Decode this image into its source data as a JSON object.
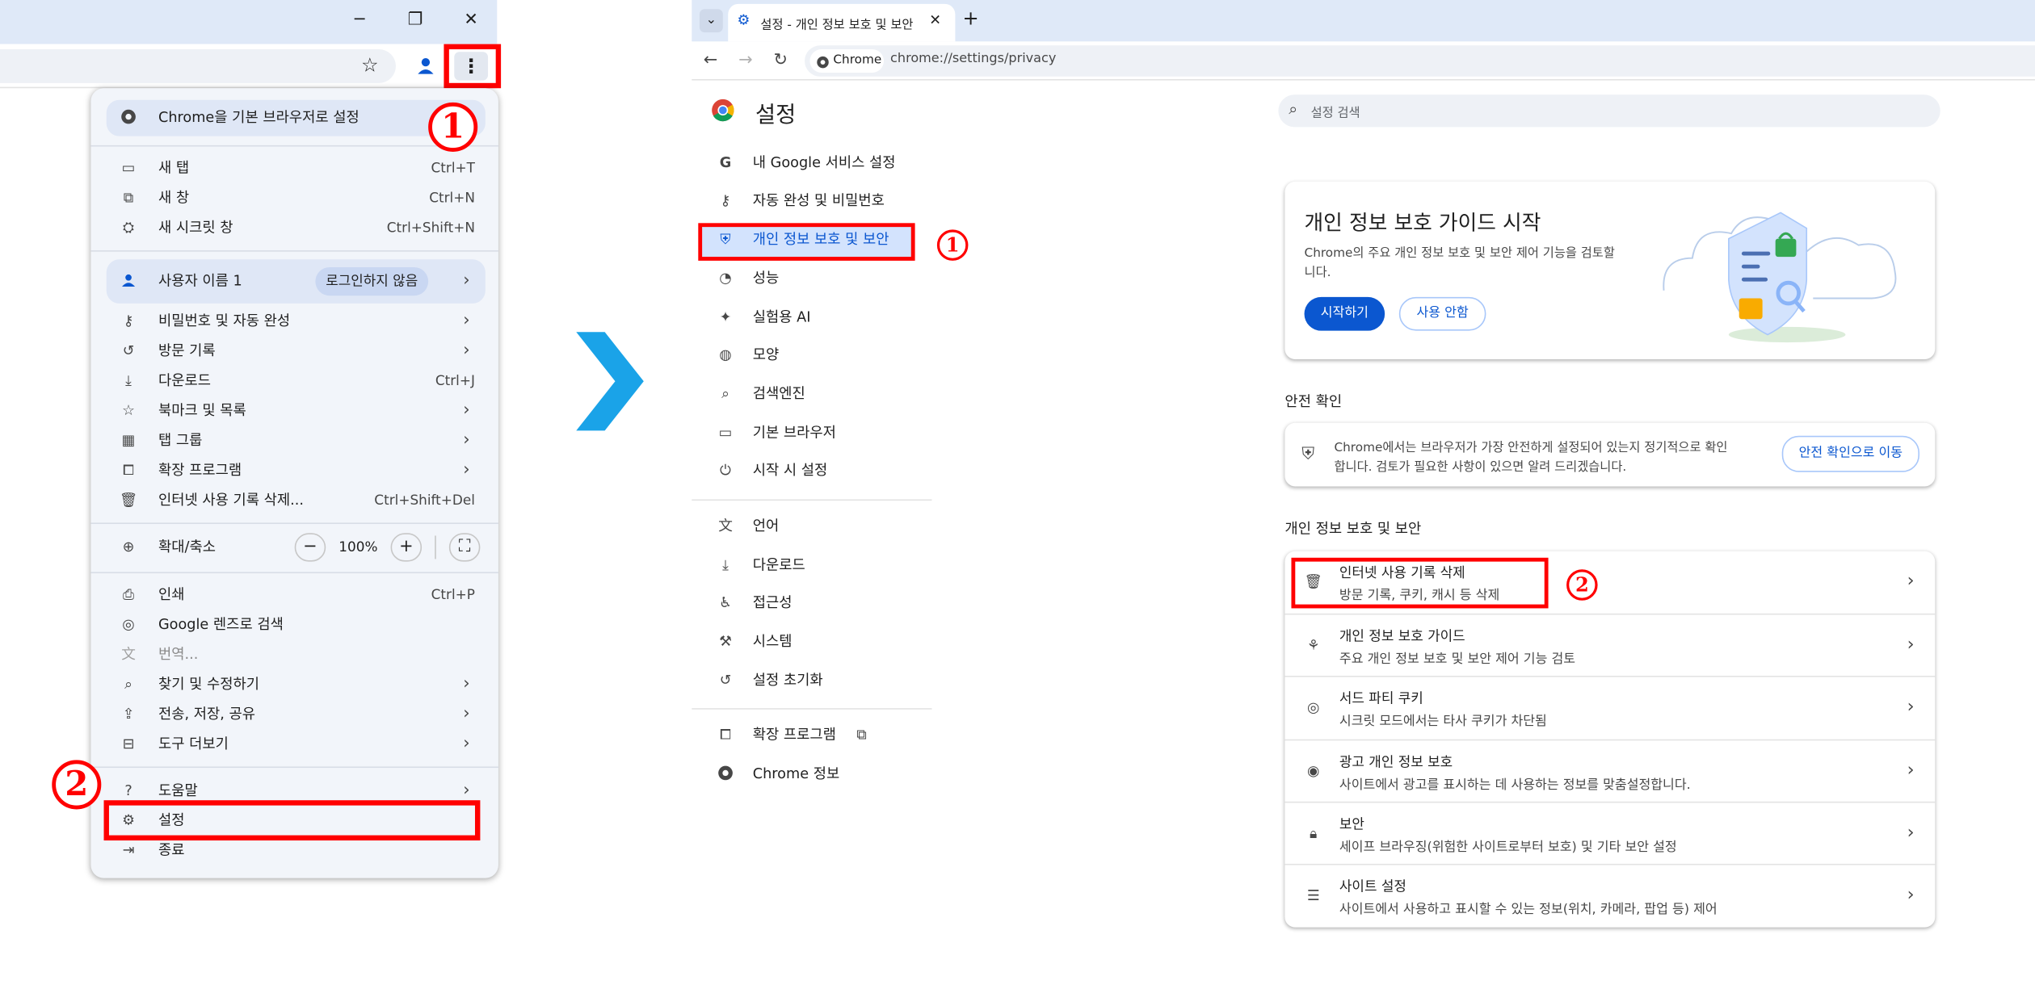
{
  "left_window": {
    "win_min": "─",
    "win_max": "❐",
    "win_close": "✕",
    "star": "☆",
    "menu_dots": "⋮",
    "menu": {
      "default_browser": "Chrome을 기본 브라우저로 설정",
      "new_tab": {
        "label": "새 탭",
        "shortcut": "Ctrl+T"
      },
      "new_window": {
        "label": "새 창",
        "shortcut": "Ctrl+N"
      },
      "incognito": {
        "label": "새 시크릿 창",
        "shortcut": "Ctrl+Shift+N"
      },
      "profile": {
        "label": "사용자 이름 1",
        "badge": "로그인하지 않음"
      },
      "passwords": "비밀번호 및 자동 완성",
      "history": "방문 기록",
      "downloads": {
        "label": "다운로드",
        "shortcut": "Ctrl+J"
      },
      "bookmarks": "북마크 및 목록",
      "tab_groups": "탭 그룹",
      "extensions": "확장 프로그램",
      "clear_data": {
        "label": "인터넷 사용 기록 삭제...",
        "shortcut": "Ctrl+Shift+Del"
      },
      "zoom": {
        "label": "확대/축소",
        "minus": "−",
        "value": "100%",
        "plus": "+"
      },
      "print": {
        "label": "인쇄",
        "shortcut": "Ctrl+P"
      },
      "lens": "Google 렌즈로 검색",
      "translate": "번역...",
      "find": "찾기 및 수정하기",
      "cast": "전송, 저장, 공유",
      "more_tools": "도구 더보기",
      "help": "도움말",
      "settings": "설정",
      "exit": "종료"
    },
    "marker1": "1",
    "marker2": "2"
  },
  "arrow_color": "#1aa3e8",
  "right_window": {
    "tab_title": "설정 - 개인 정보 보호 및 보안",
    "new_tab": "+",
    "chip": "Chrome",
    "url": "chrome://settings/privacy",
    "header": "설정",
    "search_placeholder": "설정 검색",
    "nav": [
      "내 Google 서비스 설정",
      "자동 완성 및 비밀번호",
      "개인 정보 보호 및 보안",
      "성능",
      "실험용 AI",
      "모양",
      "검색엔진",
      "기본 브라우저",
      "시작 시 설정",
      "언어",
      "다운로드",
      "접근성",
      "시스템",
      "설정 초기화",
      "확장 프로그램",
      "Chrome 정보"
    ],
    "guide_card": {
      "title": "개인 정보 보호 가이드 시작",
      "desc_line1": "Chrome의 주요 개인 정보 보호 및 보안 제어 기능을 검토할",
      "desc_line2": "니다.",
      "start": "시작하기",
      "no_thanks": "사용 안함"
    },
    "safety_heading": "안전 확인",
    "safety_card": {
      "line1": "Chrome에서는 브라우저가 가장 안전하게 설정되어 있는지 정기적으로 확인",
      "line2": "합니다. 검토가 필요한 사항이 있으면 알려 드리겠습니다.",
      "button": "안전 확인으로 이동"
    },
    "privacy_heading": "개인 정보 보호 및 보안",
    "rows": [
      {
        "title": "인터넷 사용 기록 삭제",
        "sub": "방문 기록, 쿠키, 캐시 등 삭제"
      },
      {
        "title": "개인 정보 보호 가이드",
        "sub": "주요 개인 정보 보호 및 보안 제어 기능 검토"
      },
      {
        "title": "서드 파티 쿠키",
        "sub": "시크릿 모드에서는 타사 쿠키가 차단됨"
      },
      {
        "title": "광고 개인 정보 보호",
        "sub": "사이트에서 광고를 표시하는 데 사용하는 정보를 맞춤설정합니다."
      },
      {
        "title": "보안",
        "sub": "세이프 브라우징(위험한 사이트로부터 보호) 및 기타 보안 설정"
      },
      {
        "title": "사이트 설정",
        "sub": "사이트에서 사용하고 표시할 수 있는 정보(위치, 카메라, 팝업 등) 제어"
      }
    ],
    "marker1": "1",
    "marker2": "2"
  }
}
